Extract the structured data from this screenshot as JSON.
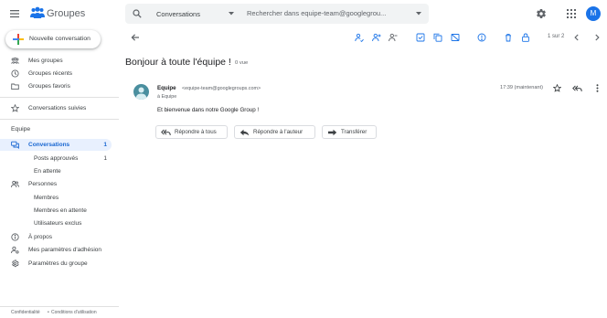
{
  "app": {
    "title": "Groupes"
  },
  "search": {
    "scope": "Conversations",
    "placeholder": "Rechercher dans equipe-team@googlegrou..."
  },
  "user": {
    "avatar_letter": "M"
  },
  "sidebar": {
    "new_conversation": "Nouvelle conversation",
    "items": [
      {
        "label": "Mes groupes",
        "icon": "groups-icon"
      },
      {
        "label": "Groupes récents",
        "icon": "clock-icon"
      },
      {
        "label": "Groupes favoris",
        "icon": "folder-icon"
      },
      {
        "label": "Conversations suivies",
        "icon": "star-icon"
      }
    ],
    "group_name": "Equipe",
    "group_items": [
      {
        "label": "Conversations",
        "count": "1",
        "icon": "conversations-icon"
      },
      {
        "label": "Posts approuvés",
        "count": "1"
      },
      {
        "label": "En attente"
      },
      {
        "label": "Personnes",
        "icon": "people-icon"
      },
      {
        "label": "Membres"
      },
      {
        "label": "Membres en attente"
      },
      {
        "label": "Utilisateurs exclus"
      },
      {
        "label": "À propos",
        "icon": "info-icon"
      },
      {
        "label": "Mes paramètres d'adhésion",
        "icon": "member-settings-icon"
      },
      {
        "label": "Paramètres du groupe",
        "icon": "gear-icon"
      }
    ],
    "footer": {
      "privacy": "Confidentialité",
      "separator": "•",
      "terms": "Conditions d'utilisation"
    }
  },
  "toolbar": {
    "pager": "1 sur 2"
  },
  "thread": {
    "title": "Bonjour à toute l'équipe !",
    "views": "0 vue",
    "message": {
      "sender": "Equipe",
      "email": "<equipe-team@googlegroups.com>",
      "recipient": "à Equipe",
      "time": "17:39 (maintenant)",
      "body": "Et bienvenue dans notre Google Group !"
    },
    "actions": {
      "reply_all": "Répondre à tous",
      "reply_author": "Répondre à l'auteur",
      "forward": "Transférer"
    }
  },
  "colors": {
    "accent": "#1a73e8",
    "active_bg": "#e8f0fe",
    "active_text": "#1967d2",
    "avatar_msg": "#4a8f9f"
  }
}
